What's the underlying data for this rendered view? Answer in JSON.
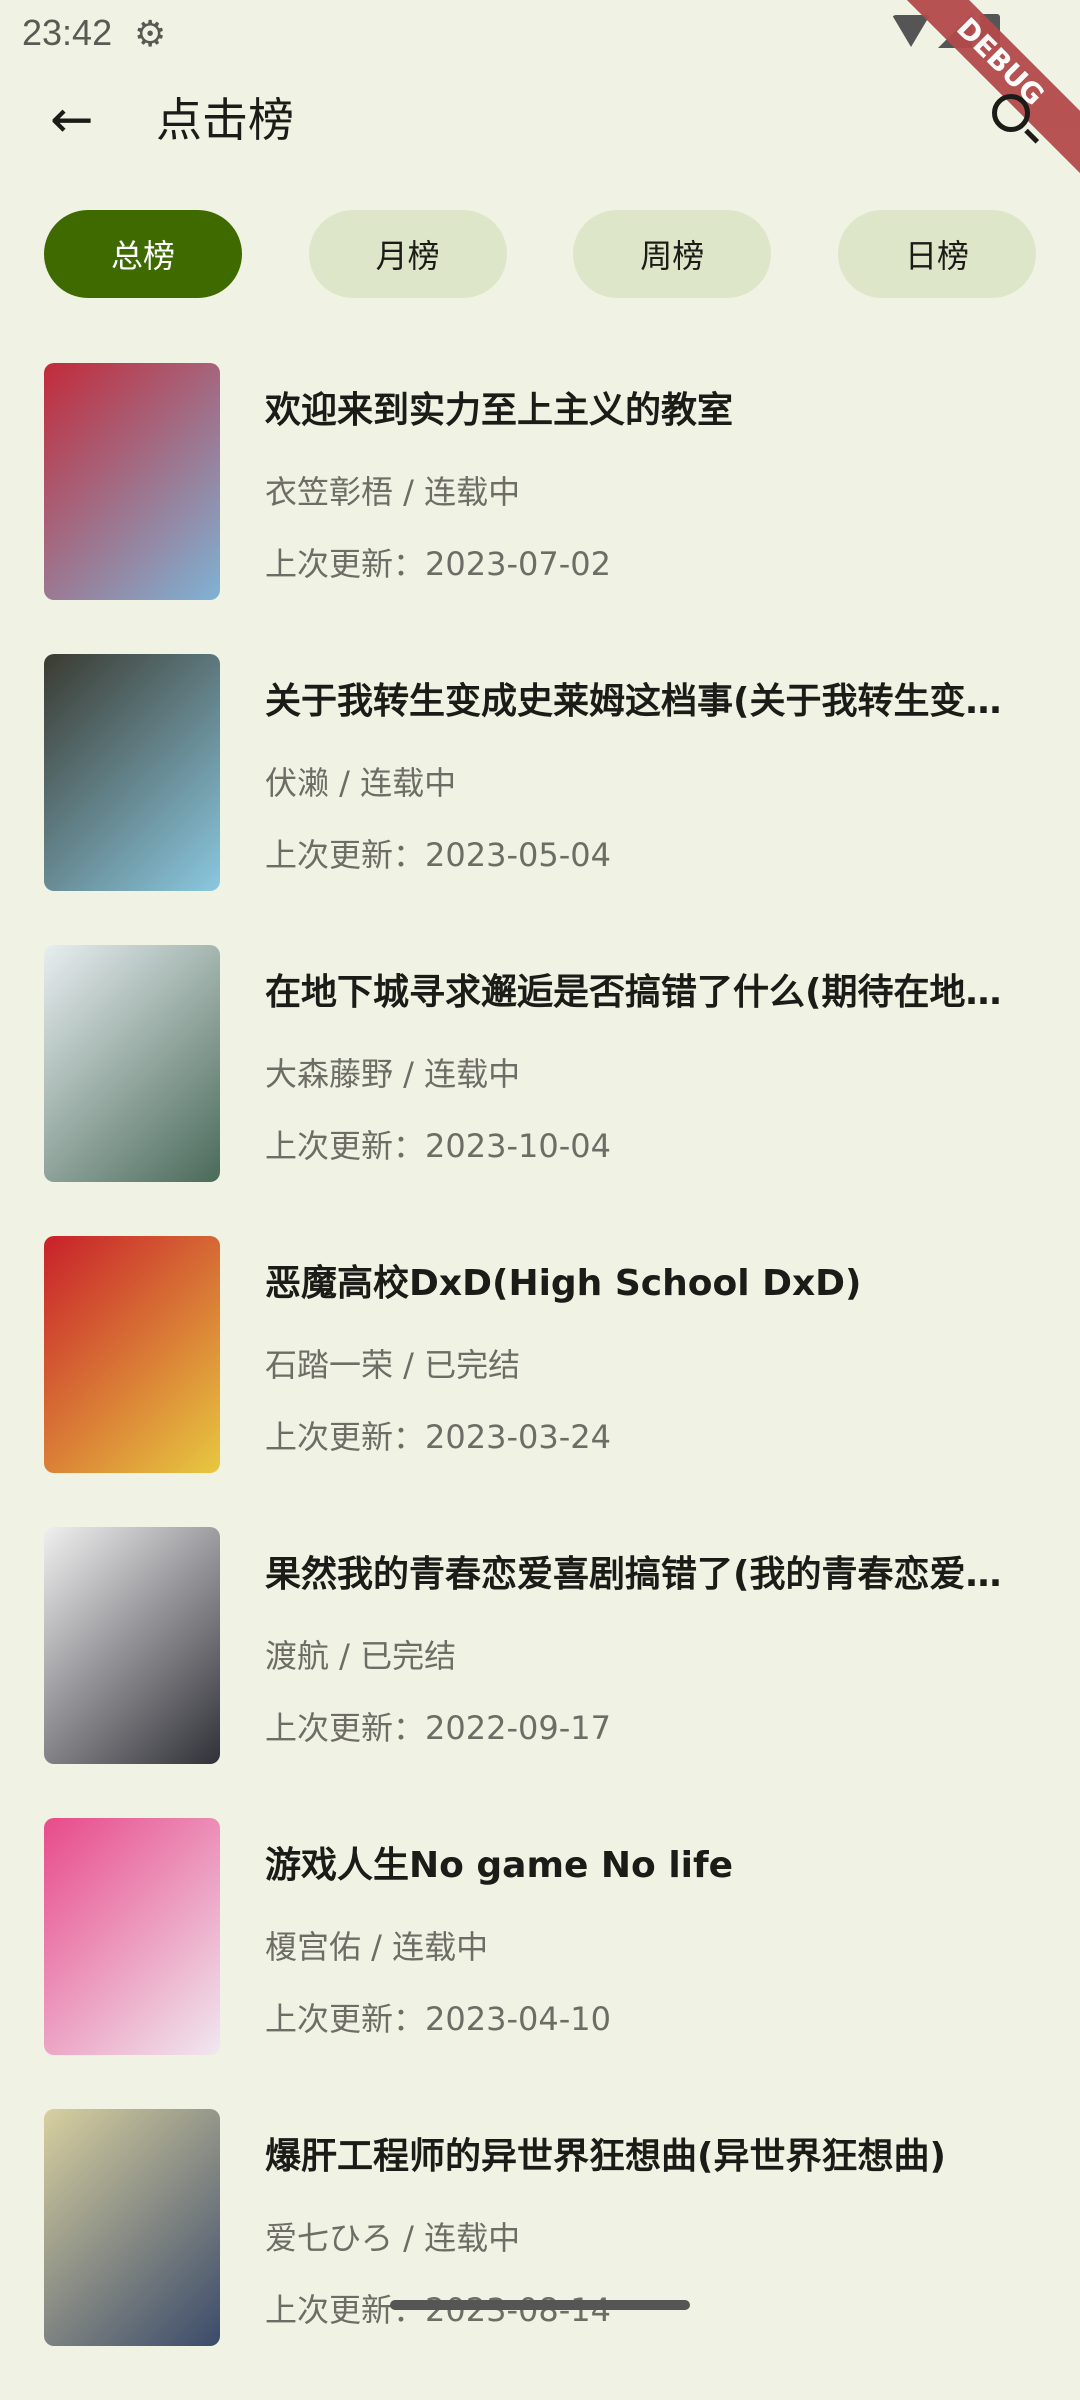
{
  "status": {
    "time": "23:42",
    "settings_icon": "gear-icon"
  },
  "debug_banner": "DEBUG",
  "appbar": {
    "title": "点击榜"
  },
  "tabs": [
    {
      "label": "总榜",
      "selected": true
    },
    {
      "label": "月榜"
    },
    {
      "label": "周榜"
    },
    {
      "label": "日榜"
    }
  ],
  "books": [
    {
      "title": "欢迎来到实力至上主义的教室",
      "meta": "衣笠彰梧 / 连载中",
      "updated": "上次更新：2023-07-02",
      "colors": [
        "#c22a3a",
        "#7fb3d5"
      ]
    },
    {
      "title": "关于我转生变成史莱姆这档事(关于我转生变成史莱姆这档事)",
      "meta": "伏濑 / 连载中",
      "updated": "上次更新：2023-05-04",
      "colors": [
        "#3a3a30",
        "#8ac8e0"
      ]
    },
    {
      "title": "在地下城寻求邂逅是否搞错了什么(期待在地下城邂逅有错吗)",
      "meta": "大森藤野 / 连载中",
      "updated": "上次更新：2023-10-04",
      "colors": [
        "#e8eef0",
        "#4a6a5a"
      ]
    },
    {
      "title": "恶魔高校DxD(High School DxD)",
      "meta": "石踏一荣 / 已完结",
      "updated": "上次更新：2023-03-24",
      "colors": [
        "#c8202a",
        "#e8c840"
      ]
    },
    {
      "title": "果然我的青春恋爱喜剧搞错了(我的青春恋爱物语果然有问题)",
      "meta": "渡航 / 已完结",
      "updated": "上次更新：2022-09-17",
      "colors": [
        "#f0f0f0",
        "#303038"
      ]
    },
    {
      "title": "游戏人生No game No life",
      "meta": "榎宫佑 / 连载中",
      "updated": "上次更新：2023-04-10",
      "colors": [
        "#e84a8a",
        "#f0e8f0"
      ]
    },
    {
      "title": "爆肝工程师的异世界狂想曲(异世界狂想曲)",
      "meta": "爱七ひろ / 连载中",
      "updated": "上次更新：2023-08-14",
      "colors": [
        "#d8d0a0",
        "#3a4a6a"
      ]
    }
  ]
}
